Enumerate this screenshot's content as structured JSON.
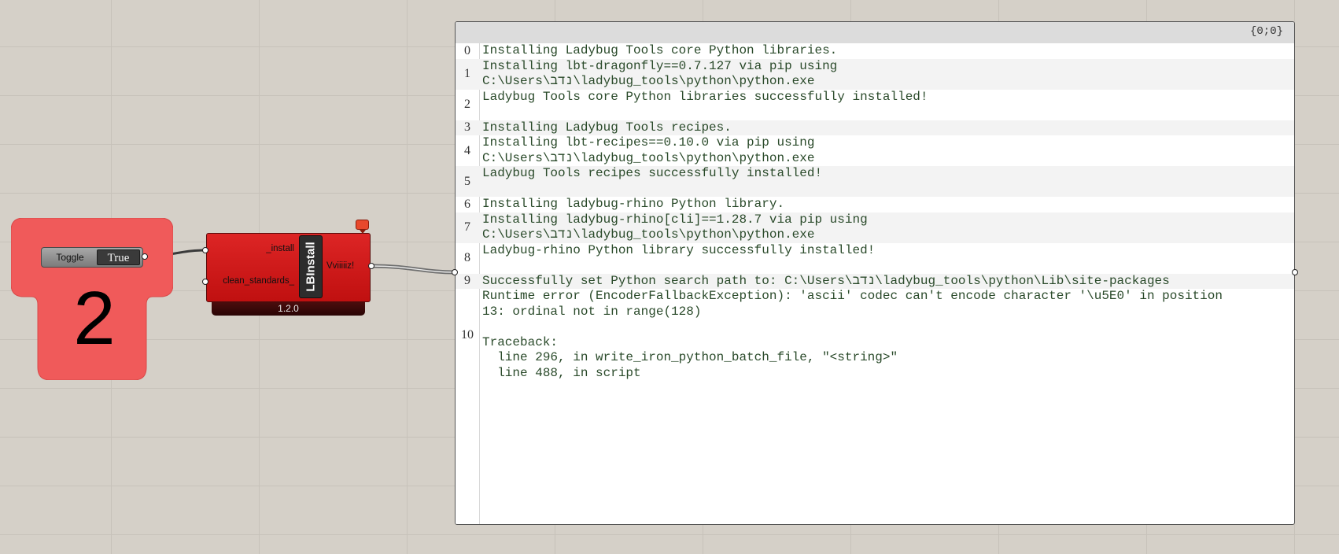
{
  "group": {
    "number": "2",
    "color": "#f05a5a"
  },
  "toggle": {
    "label": "Toggle",
    "value": "True"
  },
  "component": {
    "name": "LBInstall",
    "version": "1.2.0",
    "inputs": [
      "_install",
      "clean_standards_"
    ],
    "output": "Vviiiiiz!",
    "color": "#d41a1a"
  },
  "panel": {
    "path": "{0;0}",
    "rows": [
      {
        "index": "0",
        "lines": [
          "Installing Ladybug Tools core Python libraries."
        ]
      },
      {
        "index": "1",
        "lines": [
          "Installing lbt-dragonfly==0.7.127 via pip using",
          "C:\\Users\\נדב\\ladybug_tools\\python\\python.exe"
        ]
      },
      {
        "index": "2",
        "lines": [
          "Ladybug Tools core Python libraries successfully installed!",
          ""
        ]
      },
      {
        "index": "3",
        "lines": [
          "Installing Ladybug Tools recipes."
        ]
      },
      {
        "index": "4",
        "lines": [
          "Installing lbt-recipes==0.10.0 via pip using",
          "C:\\Users\\נדב\\ladybug_tools\\python\\python.exe"
        ]
      },
      {
        "index": "5",
        "lines": [
          "Ladybug Tools recipes successfully installed!",
          ""
        ]
      },
      {
        "index": "6",
        "lines": [
          "Installing ladybug-rhino Python library."
        ]
      },
      {
        "index": "7",
        "lines": [
          "Installing ladybug-rhino[cli]==1.28.7 via pip using",
          "C:\\Users\\נדב\\ladybug_tools\\python\\python.exe"
        ]
      },
      {
        "index": "8",
        "lines": [
          "Ladybug-rhino Python library successfully installed!",
          ""
        ]
      },
      {
        "index": "9",
        "lines": [
          "Successfully set Python search path to: C:\\Users\\נדב\\ladybug_tools\\python\\Lib\\site-packages"
        ]
      },
      {
        "index": "10",
        "lines": [
          "Runtime error (EncoderFallbackException): 'ascii' codec can't encode character '\\u5E0' in position",
          "13: ordinal not in range(128)",
          "",
          "Traceback:",
          "  line 296, in write_iron_python_batch_file, \"<string>\"",
          "  line 488, in script"
        ]
      }
    ]
  }
}
